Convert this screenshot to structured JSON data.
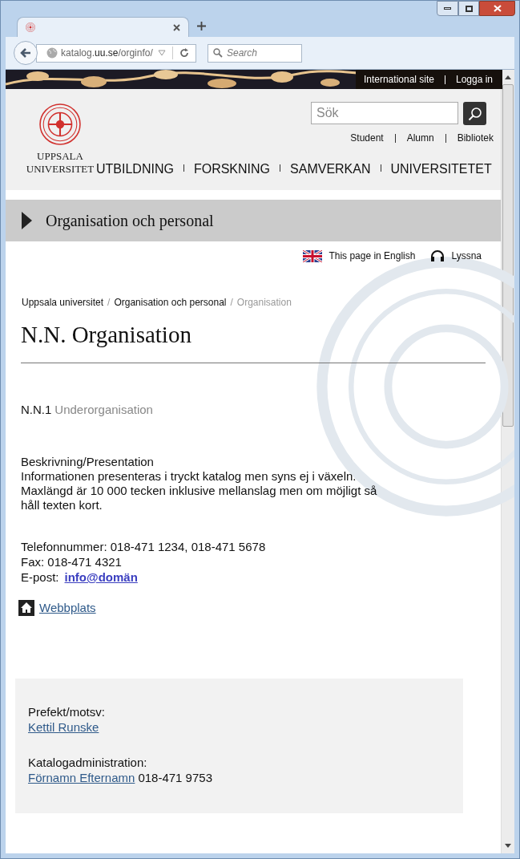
{
  "browser": {
    "url": "katalog.**uu.se**/orginfo/",
    "search_placeholder": "Search"
  },
  "top_links": [
    "International site",
    "Logga in"
  ],
  "header": {
    "search_placeholder": "Sök",
    "quick_links": [
      "Student",
      "Alumn",
      "Bibliotek"
    ],
    "logo_lines": [
      "UPPSALA",
      "UNIVERSITET"
    ],
    "nav": [
      "UTBILDNING",
      "FORSKNING",
      "SAMVERKAN",
      "UNIVERSITETET"
    ]
  },
  "section_title": "Organisation och personal",
  "tools": [
    {
      "kind": "language",
      "label": "This page in English"
    },
    {
      "kind": "listen",
      "label": "Lyssna"
    }
  ],
  "breadcrumb": [
    {
      "label": "Uppsala universitet",
      "current": false
    },
    {
      "separator": "/",
      "label": "Organisation och personal",
      "current": false
    },
    {
      "separator": "/",
      "label": "Organisation",
      "current": true
    }
  ],
  "title": "N.N. Organisation",
  "suborg": {
    "code": "N.N.1",
    "name": "Underorganisation"
  },
  "description": {
    "heading": "Beskrivning/Presentation",
    "text": "Informationen presenteras i tryckt katalog men syns ej i växeln. Maxlängd är 10 000 tecken inklusive mellanslag men om möjligt så håll texten kort."
  },
  "contact": {
    "phone": "Telefonnummer: 018-471 1234, 018-471 5678",
    "fax": "Fax: 018-471 4321",
    "email_label": "E-post:",
    "email": "info@domän"
  },
  "website": "Webbplats",
  "people": [
    {
      "role": "Prefekt/motsv:",
      "name": "Kettil Runske"
    },
    {
      "role": "Katalogadministration:",
      "name": "Förnamn Efternamn",
      "phone": "018-471 9753"
    }
  ]
}
